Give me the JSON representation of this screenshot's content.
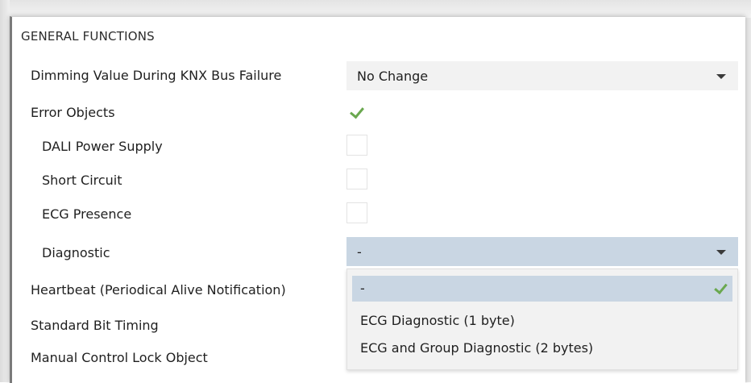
{
  "section": {
    "title": "GENERAL FUNCTIONS"
  },
  "rows": {
    "dimming": {
      "label": "Dimming Value During KNX Bus Failure",
      "value": "No Change"
    },
    "error_objects": {
      "label": "Error Objects",
      "checked": true
    },
    "dali_power": {
      "label": "DALI Power Supply",
      "checked": false
    },
    "short_circuit": {
      "label": "Short Circuit",
      "checked": false
    },
    "ecg_presence": {
      "label": "ECG Presence",
      "checked": false
    },
    "diagnostic": {
      "label": "Diagnostic",
      "value": "-"
    },
    "heartbeat": {
      "label": "Heartbeat (Periodical Alive Notification)"
    },
    "bit_timing": {
      "label": "Standard Bit Timing"
    },
    "manual_lock": {
      "label": "Manual Control Lock Object"
    }
  },
  "diagnostic_options": [
    {
      "label": "-",
      "selected": true
    },
    {
      "label": "ECG Diagnostic (1 byte)",
      "selected": false
    },
    {
      "label": "ECG and Group Diagnostic (2 bytes)",
      "selected": false
    }
  ],
  "colors": {
    "check": "#6aa84f",
    "selected_bg": "#c9d6e3",
    "field_bg": "#f2f2f2"
  },
  "icons": {
    "caret": "chevron-down-icon",
    "check": "check-icon"
  }
}
